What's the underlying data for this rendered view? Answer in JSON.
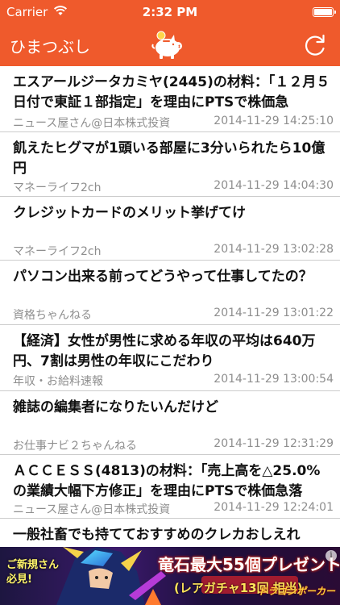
{
  "status_bar": {
    "carrier": "Carrier",
    "time": "2:32 PM",
    "wifi_icon": "wifi-icon",
    "battery_icon": "battery-icon"
  },
  "nav": {
    "title": "ひまつぶし",
    "center_icon": "piggy-bank-icon",
    "right_icon": "refresh-icon",
    "bar_color": "#ef5a2c"
  },
  "articles": [
    {
      "title": "エスアールジータカミヤ(2445)の材料：「１２月５日付で東証１部指定」を理由にPTSで株価急",
      "source": "ニュース屋さん@日本株式投資",
      "date": "2014-11-29 14:25:10"
    },
    {
      "title": "飢えたヒグマが1頭いる部屋に3分いられたら10億円",
      "source": "マネーライフ2ch",
      "date": "2014-11-29 14:04:30"
    },
    {
      "title": "クレジットカードのメリット挙げてけ",
      "source": "マネーライフ2ch",
      "date": "2014-11-29 13:02:28"
    },
    {
      "title": "パソコン出来る前ってどうやって仕事してたの？",
      "source": "資格ちゃんねる",
      "date": "2014-11-29 13:01:22"
    },
    {
      "title": "【経済】女性が男性に求める年収の平均は640万円、7割は男性の年収にこだわり",
      "source": "年収・お給料速報",
      "date": "2014-11-29 13:00:54"
    },
    {
      "title": "雑誌の編集者になりたいんだけど",
      "source": "お仕事ナビ２ちゃんねる",
      "date": "2014-11-29 12:31:29"
    },
    {
      "title": "ＡＣＣＥＳＳ(4813)の材料：「売上高を△25.0%の業績大幅下方修正」を理由にPTSで株価急落",
      "source": "ニュース屋さん@日本株式投資",
      "date": "2014-11-29 12:24:01"
    },
    {
      "title": "一般社畜でも持てておすすめのクレカおしえれ",
      "source": "",
      "date": ""
    }
  ],
  "ad": {
    "left_text_line1": "ご新規さん",
    "left_text_line2": "必見!",
    "headline": "竜石最大55個プレゼント!!",
    "sub": "(レアガチャ13回 相当)",
    "logo": "ドラゴンポーカー",
    "info_icon": "info-icon"
  }
}
